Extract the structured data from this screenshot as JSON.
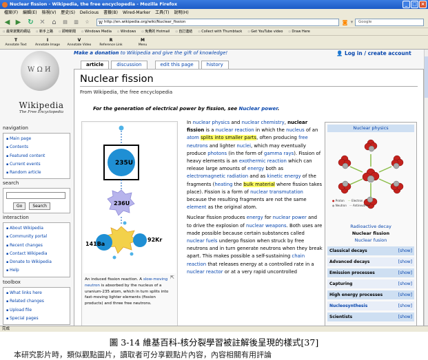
{
  "window": {
    "title": "Nuclear fission - Wikipedia, the free encyclopedia - Mozilla Firefox",
    "controls": [
      "_",
      "□",
      "×"
    ]
  },
  "menu": [
    "檔案(F)",
    "編輯(E)",
    "檢視(V)",
    "歷史(S)",
    "Delicious",
    "書籤(B)",
    "Wired-Marker",
    "工具(T)",
    "說明(H)"
  ],
  "navbar": {
    "url": "http://en.wikipedia.org/wiki/Nuclear_fission",
    "search_placeholder": "Google"
  },
  "bookmarks": [
    "最常瀏覽的網站",
    "新手上路",
    "即時新聞",
    "Windows Media",
    "Windows",
    "免費的 Hotmail",
    "自訂連結",
    "Collect with Thumbtack",
    "Get YouTube video",
    "Draw Here"
  ],
  "annotator": [
    {
      "key": "T",
      "label": "Annotate Text"
    },
    {
      "key": "I",
      "label": "Annotate Image"
    },
    {
      "key": "V",
      "label": "Annotate Video"
    },
    {
      "key": "R",
      "label": "Reference Link"
    },
    {
      "key": "M",
      "label": "Menu"
    }
  ],
  "wiki": {
    "wordmark": "Wikipedia",
    "tagline": "The Free Encyclopedia",
    "donate_text_pre": "Make a donation",
    "donate_text_post": " to Wikipedia and give the gift of knowledge!",
    "login": "Log in / create account",
    "tabs": [
      "article",
      "discussion",
      "edit this page",
      "history"
    ],
    "nav_heading": "navigation",
    "nav_items": [
      "Main page",
      "Contents",
      "Featured content",
      "Current events",
      "Random article"
    ],
    "search_heading": "search",
    "go_label": "Go",
    "search_label": "Search",
    "interaction_heading": "interaction",
    "interaction_items": [
      "About Wikipedia",
      "Community portal",
      "Recent changes",
      "Contact Wikipedia",
      "Donate to Wikipedia",
      "Help"
    ],
    "toolbox_heading": "toolbox",
    "toolbox_items": [
      "What links here",
      "Related changes",
      "Upload file",
      "Special pages"
    ]
  },
  "article": {
    "title": "Nuclear fission",
    "from": "From Wikipedia, the free encyclopedia",
    "dablink_pre": "For the generation of electrical power by fission, see ",
    "dablink_link": "Nuclear power",
    "dablink_post": ".",
    "figure": {
      "u235": "235U",
      "u236": "236U",
      "ba": "141Ba",
      "kr": "92Kr",
      "caption_pre": "An induced fission reaction. A ",
      "caption_link": "slow-moving neutron",
      "caption_post": " is absorbed by the nucleus of a uranium-235 atom, which in turn splits into fast-moving lighter elements (fission products) and three free neutrons."
    }
  },
  "infobox": {
    "header": "Nuclear physics",
    "legend": [
      "Proton",
      "Neutron",
      "Electron",
      "Antineutrino"
    ],
    "link1": "Radioactive decay",
    "bold": "Nuclear fission",
    "link2": "Nuclear fusion",
    "rows": [
      "Classical decays",
      "Advanced decays",
      "Emission processes",
      "Capturing",
      "High energy processes",
      "Nucleosynthesis",
      "Scientists"
    ],
    "show_label": "[show]"
  },
  "status": "完成",
  "caption": "圖 3-14  維基百科-核分裂學習被註解後呈現的樣式[37]",
  "cutoff_text": "本研究影片時，類似觀點圖片，讀取者可分享觀點片內容，內容相關有用評論"
}
